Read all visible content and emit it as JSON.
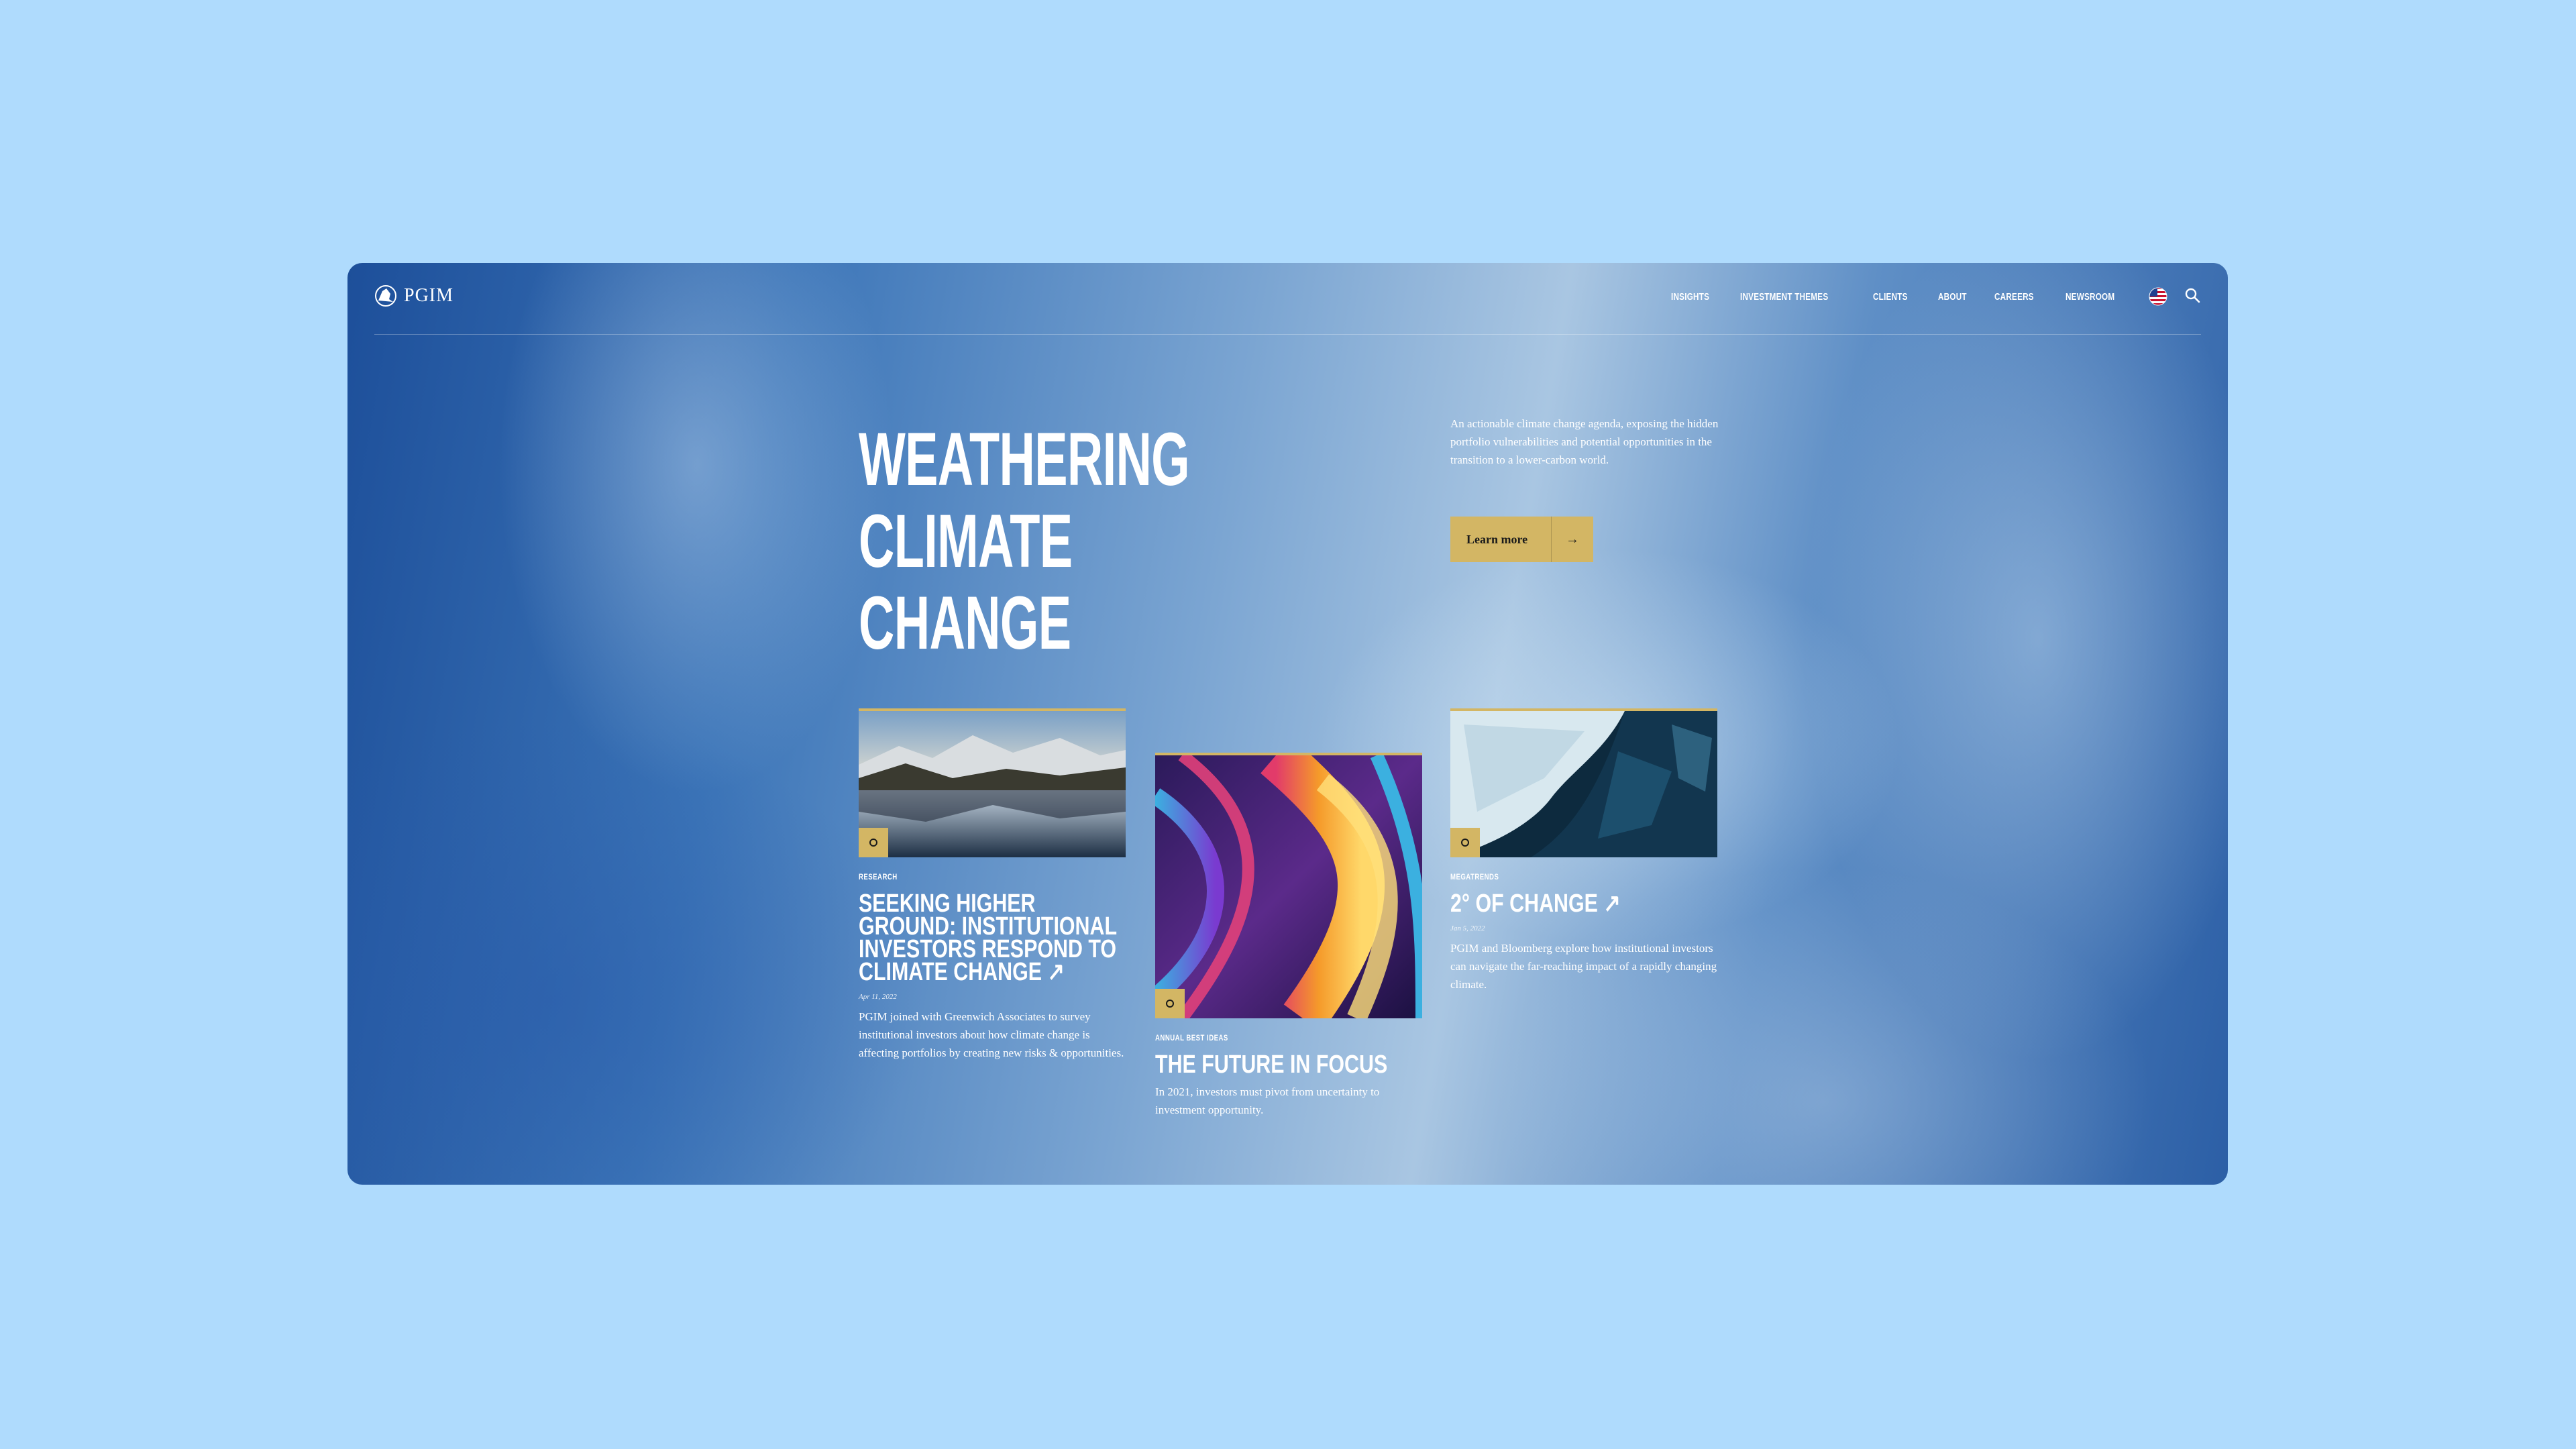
{
  "brand": {
    "name": "PGIM"
  },
  "nav": {
    "items": [
      "INSIGHTS",
      "INVESTMENT THEMES",
      "CLIENTS",
      "ABOUT",
      "CAREERS",
      "NEWSROOM"
    ]
  },
  "hero": {
    "headline_line1": "WEATHERING",
    "headline_line2": "CLIMATE CHANGE",
    "intro": "An actionable climate change agenda, exposing the hidden portfolio vulnerabilities and potential opportunities in the transition to a lower-carbon world.",
    "cta_label": "Learn more"
  },
  "cards": [
    {
      "eyebrow": "RESEARCH",
      "title": "SEEKING HIGHER GROUND: INSTITUTIONAL INVESTORS RESPOND TO CLIMATE CHANGE ↗",
      "date": "Apr 11, 2022",
      "description": "PGIM joined with Greenwich Associates to survey institutional investors about how climate change is affecting portfolios by creating new risks & opportunities."
    },
    {
      "eyebrow": "ANNUAL BEST IDEAS",
      "title": "THE FUTURE IN FOCUS",
      "description": "In 2021, investors must pivot from uncertainty to investment opportunity."
    },
    {
      "eyebrow": "MEGATRENDS",
      "title": "2° OF CHANGE ↗",
      "date": "Jan 5, 2022",
      "description": "PGIM and Bloomberg explore how institutional investors can navigate the far-reaching impact of a rapidly changing climate."
    }
  ],
  "colors": {
    "accent": "#d3b664",
    "page_bg": "#afdbfd"
  }
}
